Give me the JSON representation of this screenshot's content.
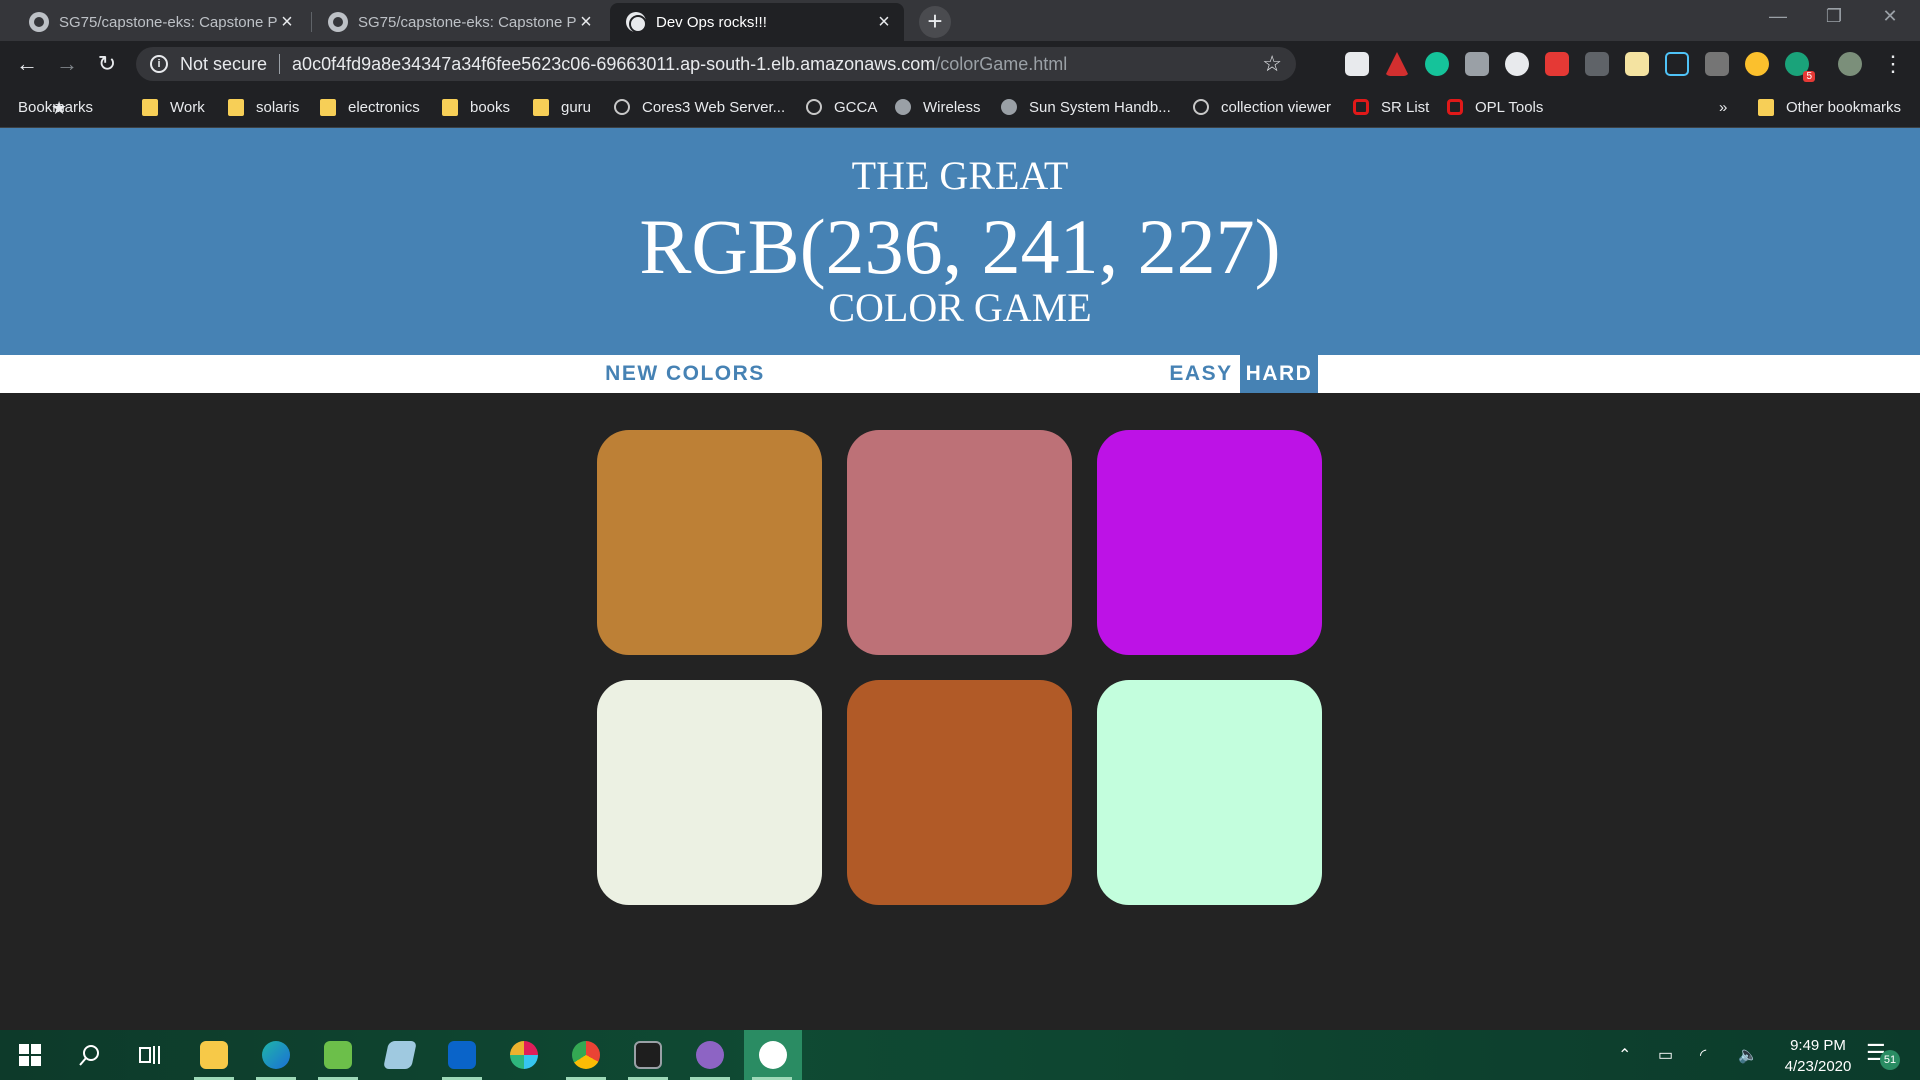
{
  "browser": {
    "tabs": [
      {
        "title": "SG75/capstone-eks: Capstone Pr",
        "icon": "github-icon",
        "active": false
      },
      {
        "title": "SG75/capstone-eks: Capstone Pr",
        "icon": "github-icon",
        "active": false
      },
      {
        "title": "Dev Ops rocks!!!",
        "icon": "globe-icon",
        "active": true
      }
    ],
    "new_tab": "+",
    "omnibox": {
      "security": "Not secure",
      "host": "a0c0f4fd9a8e34347a34f6fee5623c06-69663011.ap-south-1.elb.amazonaws.com",
      "path": "/colorGame.html"
    },
    "bookmarks": [
      {
        "label": "Bookmarks",
        "icon": "star-icon"
      },
      {
        "label": "Work",
        "icon": "folder-icon"
      },
      {
        "label": "solaris",
        "icon": "folder-icon"
      },
      {
        "label": "electronics",
        "icon": "folder-icon"
      },
      {
        "label": "books",
        "icon": "folder-icon"
      },
      {
        "label": "guru",
        "icon": "folder-icon"
      },
      {
        "label": "Cores3 Web Server...",
        "icon": "globe-icon"
      },
      {
        "label": "GCCA",
        "icon": "globe-icon"
      },
      {
        "label": "Wireless",
        "icon": "wireless-icon"
      },
      {
        "label": "Sun System Handb...",
        "icon": "sun-icon"
      },
      {
        "label": "collection viewer",
        "icon": "globe-icon"
      },
      {
        "label": "SR List",
        "icon": "oracle-icon"
      },
      {
        "label": "OPL Tools",
        "icon": "oracle-icon"
      }
    ],
    "overflow": "»",
    "other_bookmarks": "Other bookmarks"
  },
  "game": {
    "title_top": "The Great",
    "color_display": "RGB(236, 241, 227)",
    "title_bottom": "Color Game",
    "new_colors": "New Colors",
    "easy": "Easy",
    "hard": "Hard",
    "selected_mode": "hard",
    "square_colors": [
      "#bd8036",
      "#bd7177",
      "#bd12e6",
      "#ecf1e3",
      "#b15a27",
      "#c3fedd"
    ]
  },
  "taskbar": {
    "clock_time": "9:49 PM",
    "clock_date": "4/23/2020",
    "extension_badge": "5",
    "notification_count": "51"
  },
  "colors": {
    "header": "#4682b4",
    "background": "#232323"
  }
}
